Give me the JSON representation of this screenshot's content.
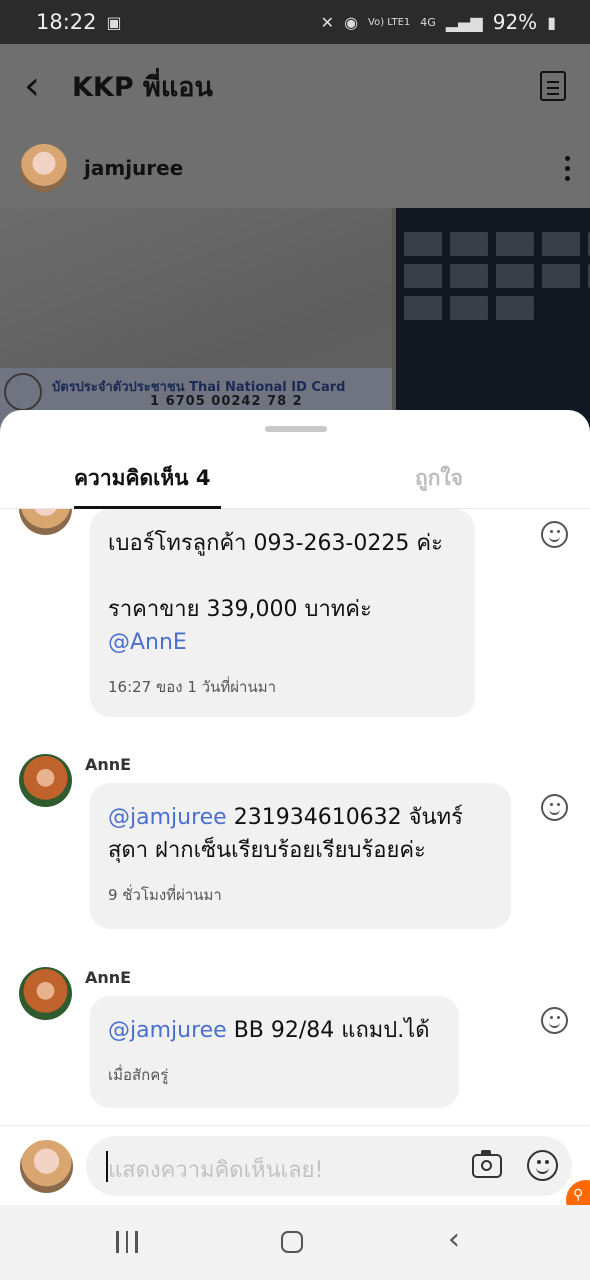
{
  "status_bar": {
    "time": "18:22",
    "battery": "92%",
    "network": "4G",
    "volte": "Vo) LTE1"
  },
  "header": {
    "title": "KKP พี่แอน"
  },
  "post": {
    "username": "jamjuree",
    "id_card_text": "บัตรประจำตัวประชาชน Thai National ID Card",
    "id_number": "1 6705 00242 78 2"
  },
  "sheet": {
    "tabs": [
      {
        "label": "ความคิดเห็น 4",
        "active": true
      },
      {
        "label": "ถูกใจ",
        "active": false
      }
    ],
    "comments": [
      {
        "author": "",
        "text_line1": "เบอร์โทรลูกค้า 093-263-0225 ค่ะ",
        "text_line2": "ราคาขาย 339,000 บาทค่ะ",
        "mention": "@AnnE",
        "time": "16:27 ของ 1 วันที่ผ่านมา"
      },
      {
        "author": "AnnE",
        "mention": "@jamjuree",
        "text": " 231934610632 จันทร์สุดา ฝากเซ็นเรียบร้อยเรียบร้อยค่ะ",
        "time": "9 ชั่วโมงที่ผ่านมา"
      },
      {
        "author": "AnnE",
        "mention": "@jamjuree",
        "text": " BB 92/84 แถมป.ได้",
        "time": "เมื่อสักครู่"
      }
    ],
    "input_placeholder": "แสดงความคิดเห็นเลย!"
  },
  "colors": {
    "mention": "#4a6fcf",
    "accent_fab": "#ff6a00",
    "bubble": "#f1f1f1"
  }
}
